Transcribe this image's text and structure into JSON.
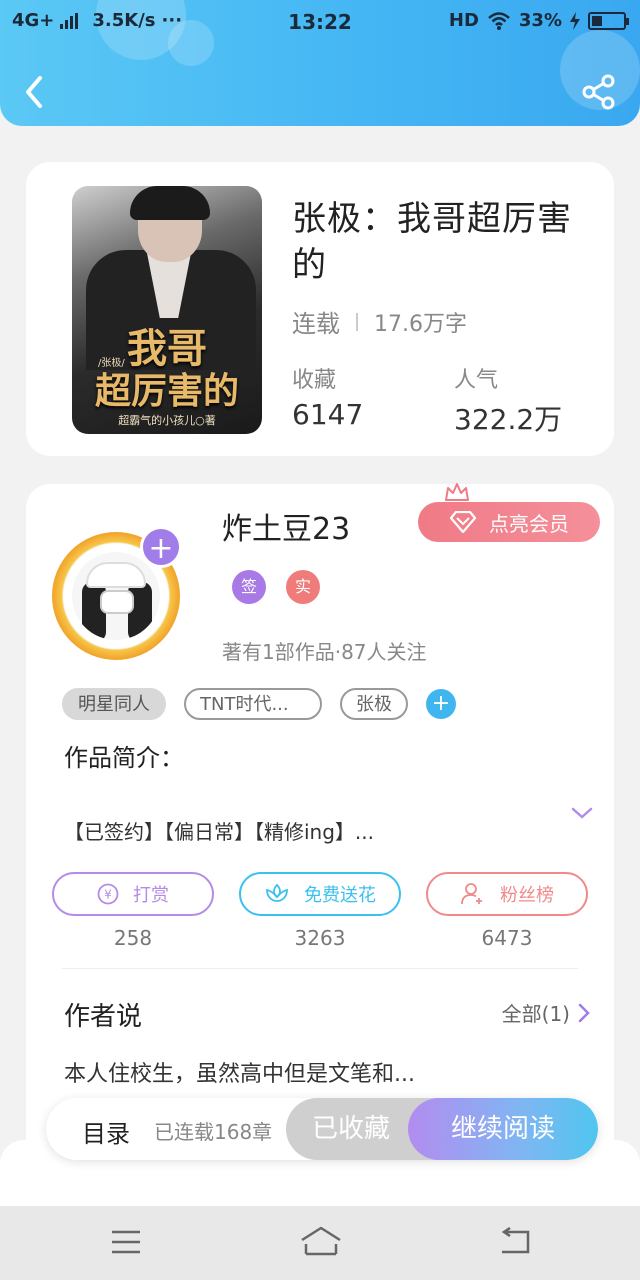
{
  "status_bar": {
    "network": "4G+",
    "speed": "3.5K/s",
    "more": "···",
    "time": "13:22",
    "hd": "HD",
    "battery": "33%",
    "battery_level": 0.33
  },
  "book": {
    "title": "张极：我哥超厉害的",
    "status": "连载",
    "word_count": "17.6万字",
    "favorites_label": "收藏",
    "favorites_value": "6147",
    "popularity_label": "人气",
    "popularity_value": "322.2万",
    "cover": {
      "title_line1": "我哥",
      "title_line2": "超厉害的",
      "tag": "/张极/",
      "author": "超霸气的小孩儿○著"
    }
  },
  "author": {
    "name": "炸土豆23",
    "vip_label": "点亮会员",
    "badges": [
      {
        "label": "签",
        "color": "#a97ae6"
      },
      {
        "label": "实",
        "color": "#f07b7b"
      }
    ],
    "info": "著有1部作品·87人关注",
    "tags": [
      "明星同人",
      "TNT时代...",
      "张极"
    ]
  },
  "intro": {
    "title": "作品简介：",
    "text": "【已签约】【偏日常】【精修ing】..."
  },
  "actions": [
    {
      "label": "打赏",
      "count": "258",
      "color": "#b48be8"
    },
    {
      "label": "免费送花",
      "count": "3263",
      "color": "#3cc1ef"
    },
    {
      "label": "粉丝榜",
      "count": "6473",
      "color": "#f08a8a"
    }
  ],
  "author_says": {
    "title": "作者说",
    "all_label": "全部(1)",
    "text": "本人住校生，虽然高中但是文笔和..."
  },
  "bottom_bar": {
    "toc_label": "目录",
    "toc_info": "已连载168章",
    "fav_label": "已收藏",
    "read_label": "继续阅读"
  }
}
